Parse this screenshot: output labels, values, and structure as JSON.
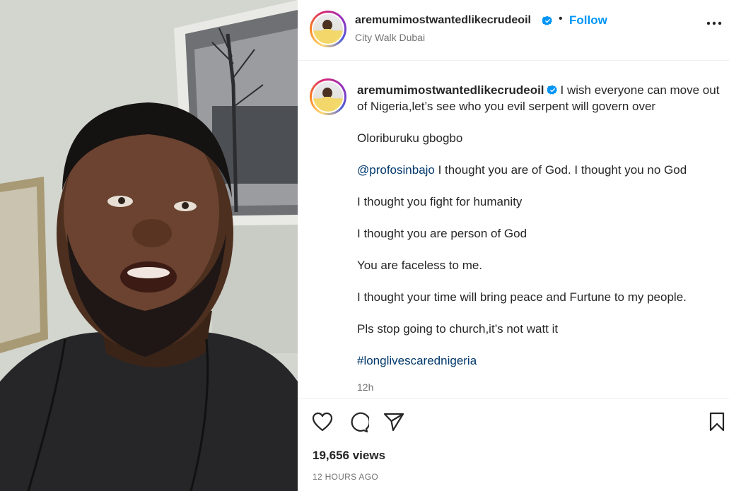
{
  "post": {
    "username": "aremumimostwantedlikecrudeoil",
    "verified": true,
    "separator": "•",
    "follow_label": "Follow",
    "location": "City Walk Dubai",
    "more_icon": "more-horizontal-icon"
  },
  "caption": {
    "username": "aremumimostwantedlikecrudeoil",
    "first_line": "I wish everyone can move out of Nigeria,let’s see who you evil serpent will govern over",
    "p1": "Oloriburuku gbogbo",
    "mention": "@profosinbajo",
    "p2_rest": " I thought you are of God. I thought you no God",
    "p3": "I thought you fight for humanity",
    "p4": "I thought you are person of God",
    "p5": "You are faceless to me.",
    "p6": "I thought your time will bring peace and Furtune to my people.",
    "p7": "Pls stop going to church,it’s not watt it",
    "hashtag": "#longlivescarednigeria",
    "time": "12h"
  },
  "actions": {
    "like_icon": "heart-icon",
    "comment_icon": "comment-icon",
    "share_icon": "send-icon",
    "save_icon": "bookmark-icon",
    "views": "19,656 views",
    "timestamp": "12 HOURS AGO"
  },
  "colors": {
    "link": "#0095f6",
    "hashtag": "#00376b",
    "muted": "#737373",
    "verified": "#0095f6"
  }
}
